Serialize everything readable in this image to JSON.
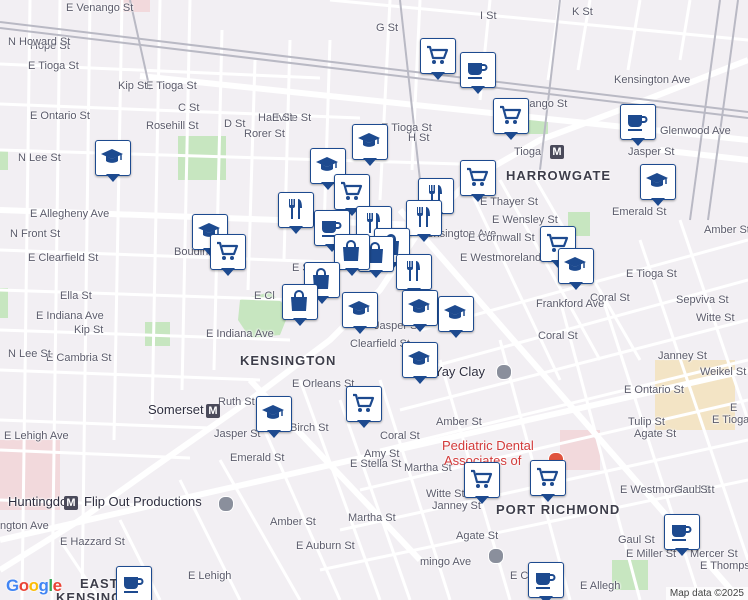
{
  "map": {
    "google_logo": "Google",
    "attribution": "Map data ©2025",
    "icons": {
      "shopping_cart": "shopping-cart-icon",
      "coffee_cup": "coffee-cup-icon",
      "graduation_cap": "graduation-cap-icon",
      "fork_knife": "fork-knife-icon",
      "shopping_bag": "shopping-bag-icon"
    },
    "colors": {
      "marker_border": "#1d4a8f",
      "marker_glyph": "#1d4a8f",
      "background": "#f2eff3",
      "park": "#c7e6c0",
      "rail": "#b9b9c4",
      "major_road": "#ffffff"
    }
  },
  "labels": {
    "e_venango_nw": "E Venango St",
    "e_tioga_w": "E Tioga St",
    "e_ontario_w": "E Ontario St",
    "e_allegheny": "E Allegheny Ave",
    "e_clearfield_w": "E Clearfield St",
    "e_indiana": "E Indiana Ave",
    "e_cambria": "E Cambria St",
    "e_lehigh": "E Lehigh Ave",
    "kip_st": "Kip St",
    "rosehill": "Rosehill St",
    "c_st": "C St",
    "d_st": "D St",
    "rorer": "Rorer St",
    "hartville": "Hartville St",
    "e_st": "E St",
    "n_lee": "N Lee St",
    "hope": "Hope St",
    "n_howard": "N Howard St",
    "n_front": "N Front St",
    "boudinot": "Boudinot St",
    "ella": "Ella St",
    "g_st": "G St",
    "h_st": "H St",
    "i_st": "I St",
    "k_st": "K St",
    "e_tioga_mid": "E Tioga St",
    "e_venango_e": "E Venango St",
    "kensington_ave_ne": "Kensington Ave",
    "glenwood": "Glenwood Ave",
    "tioga_station": "Tioga",
    "harrowgate": "HARROWGATE",
    "kensington_ave_mid": "Kensington Ave",
    "e_thayer": "E Thayer St",
    "e_wensley": "E Wensley St",
    "e_cornwall": "E Cornwall St",
    "e_westmoreland_mid": "E Westmoreland St",
    "jasper_ne": "Jasper St",
    "emerald_ne": "Emerald St",
    "amber_e": "Amber St",
    "frankford_ave": "Frankford Ave",
    "coral_e": "Coral St",
    "coral_mid": "Coral St",
    "e_tioga_e": "E Tioga St",
    "sepviva": "Sepviva St",
    "witte_e": "Witte St",
    "janney_e": "Janney St",
    "weikel": "Weikel St",
    "e_ontario_e": "E Ontario St",
    "tulip": "Tulip St",
    "agate_e": "Agate St",
    "kensington_area": "KENSINGTON",
    "clearfield_diag": "Clearfield St",
    "jasper_mid": "Jasper St",
    "yay_clay": "Yay Clay",
    "ruth": "Ruth St",
    "e_orleans": "E Orleans St",
    "somerset": "Somerset",
    "jasper_sw": "Jasper St",
    "emerald_sw": "Emerald St",
    "birch": "Birch St",
    "coral_s": "Coral St",
    "amber_s": "Amber St",
    "amber_sw": "Amber St",
    "amy": "Amy St",
    "e_stella": "E Stella St",
    "martha": "Martha St",
    "martha_sw": "Martha St",
    "pediatric_dental": "Pediatric Dental",
    "associates_of": "Associates of",
    "witte_s": "Witte St",
    "janney_s": "Janney St",
    "huntingdon": "Huntingdon",
    "flip_out": "Flip Out Productions",
    "port_richmond": "PORT RICHMOND",
    "agate_s": "Agate St",
    "amber_far_sw": "Amber St",
    "e_auburn": "E Auburn St",
    "e_hazzard": "E Hazzard St",
    "e_lehigh_s": "E Lehigh",
    "e_westmoreland_se": "E Westmoreland St",
    "gaul_e": "Gaul St",
    "gaul_s": "Gaul St",
    "e_miller": "E Miller St",
    "mercer": "Mercer St",
    "e_thompson": "E Thompson",
    "e_clearfield_s": "E Clea",
    "e_allegheny_s": "E Allegh",
    "flamingo": "mingo Ave",
    "east": "EAST",
    "kensington_sw": "KENSINGTON",
    "e_cl_w": "E Cl",
    "e_st_w": "E St",
    "e_venango_top": "E Venango St",
    "e_tioga_top": "E Tioga St",
    "lower_ave": "ngton Ave",
    "dondoll": "Jasper St",
    "e_torresdale": "E Tioga",
    "right_e": "E"
  }
}
